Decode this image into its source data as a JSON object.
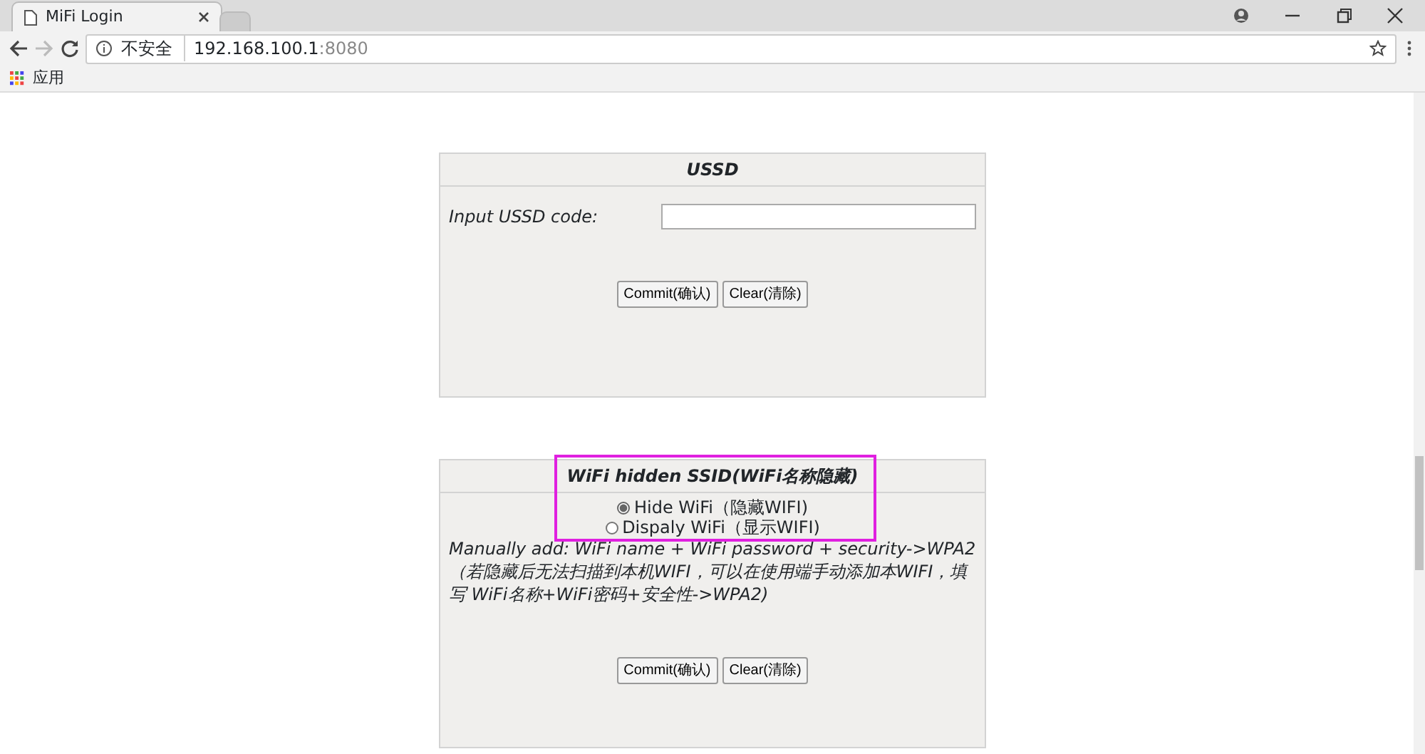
{
  "browser": {
    "tabs": [
      {
        "title": "MiFi Login",
        "selected": true
      },
      {
        "selected": false
      }
    ],
    "security_label": "不安全",
    "url_host": "192.168.100.1",
    "url_port": ":8080",
    "bookmarks": [
      {
        "label": "应用"
      }
    ]
  },
  "panels": [
    {
      "kind": "ussd",
      "title": "USSD",
      "highlighted": false,
      "field_label": "Input USSD code:",
      "buttons": [
        "Commit(确认)",
        "Clear(清除)"
      ]
    },
    {
      "kind": "wifi",
      "title": "WiFi hidden SSID(WiFi名称隐藏)",
      "highlighted": true,
      "options": [
        {
          "label": "Hide WiFi（隐藏WIFI)",
          "selected": true
        },
        {
          "label": "Dispaly WiFi（显示WIFI)",
          "selected": false
        }
      ],
      "note": "Manually add: WiFi name + WiFi password + security->WPA2 （若隐藏后无法扫描到本机WIFI，可以在使用端手动添加本WIFI，填写 WiFi名称+WiFi密码+安全性->WPA2)",
      "buttons": [
        "Commit(确认)",
        "Clear(清除)"
      ]
    }
  ]
}
